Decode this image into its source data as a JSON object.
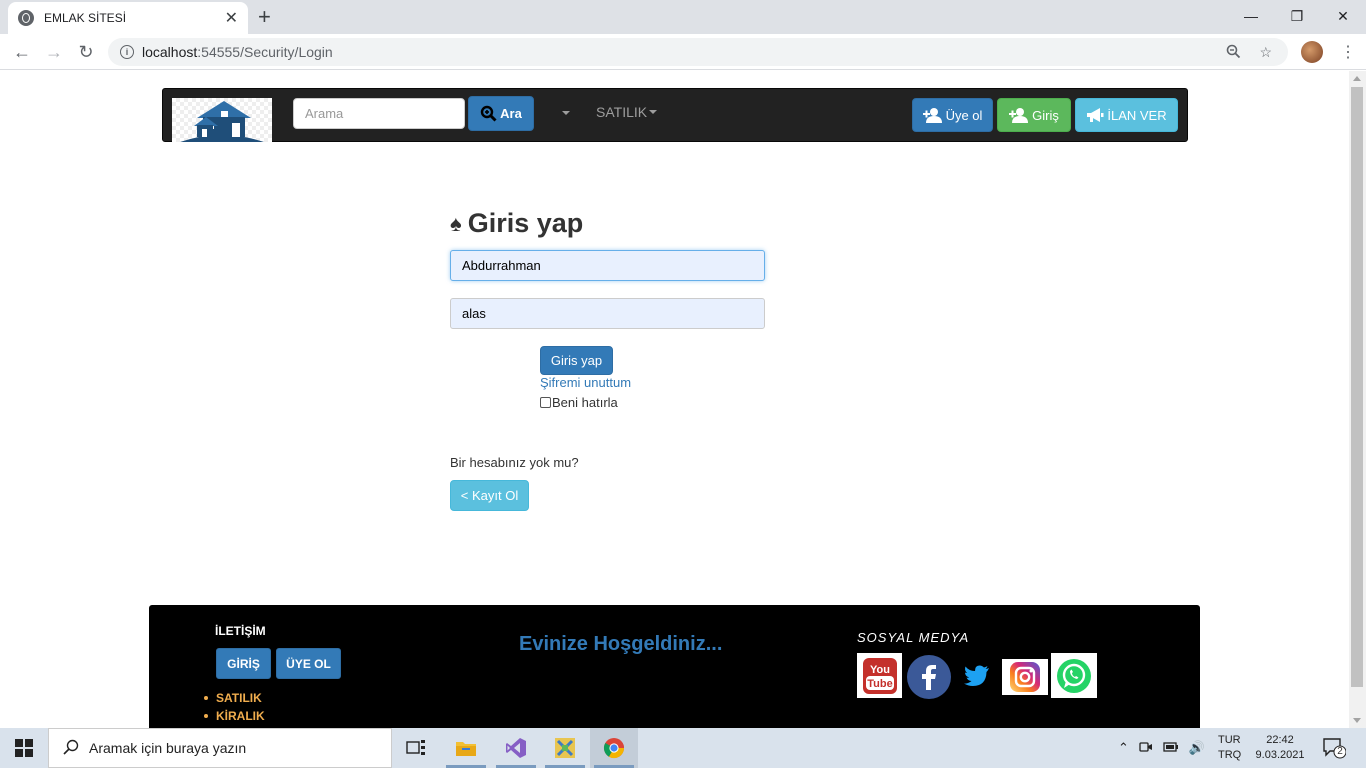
{
  "browser": {
    "tab_title": "EMLAK SİTESİ",
    "tab_close": "✕",
    "new_tab": "+",
    "url_host": "localhost",
    "url_path": ":54555/Security/Login"
  },
  "navbar": {
    "search_placeholder": "Arama",
    "search_button": "Ara",
    "satilik_menu": "SATILIK",
    "uye_ol": "Üye ol",
    "giris": "Giriş",
    "ilan_ver": "İLAN VER"
  },
  "login": {
    "title": "Giris yap",
    "username_value": "Abdurrahman",
    "password_value": "alas",
    "submit": "Giris yap",
    "forgot": "Şifremi unuttum",
    "remember": "Beni hatırla",
    "no_account": "Bir hesabınız yok mu?",
    "register": "< Kayıt Ol"
  },
  "footer": {
    "iletisim": "İLETİŞİM",
    "btn_giris": "GİRİŞ",
    "btn_uye": "ÜYE OL",
    "links": [
      "SATILIK",
      "KİRALIK"
    ],
    "welcome": "Evinize Hoşgeldiniz...",
    "sosyal": "SOSYAL MEDYA",
    "social_icons": [
      "youtube-icon",
      "facebook-icon",
      "twitter-icon",
      "instagram-icon",
      "whatsapp-icon"
    ]
  },
  "taskbar": {
    "search_text": "Aramak için buraya yazın",
    "lang_1": "TUR",
    "lang_2": "TRQ",
    "time": "22:42",
    "date": "9.03.2021",
    "notifications": "2"
  },
  "colors": {
    "primary": "#337ab7",
    "success": "#5cb85c",
    "info": "#5bc0de",
    "warning": "#f0ad4e",
    "navbar_bg": "#222222"
  }
}
